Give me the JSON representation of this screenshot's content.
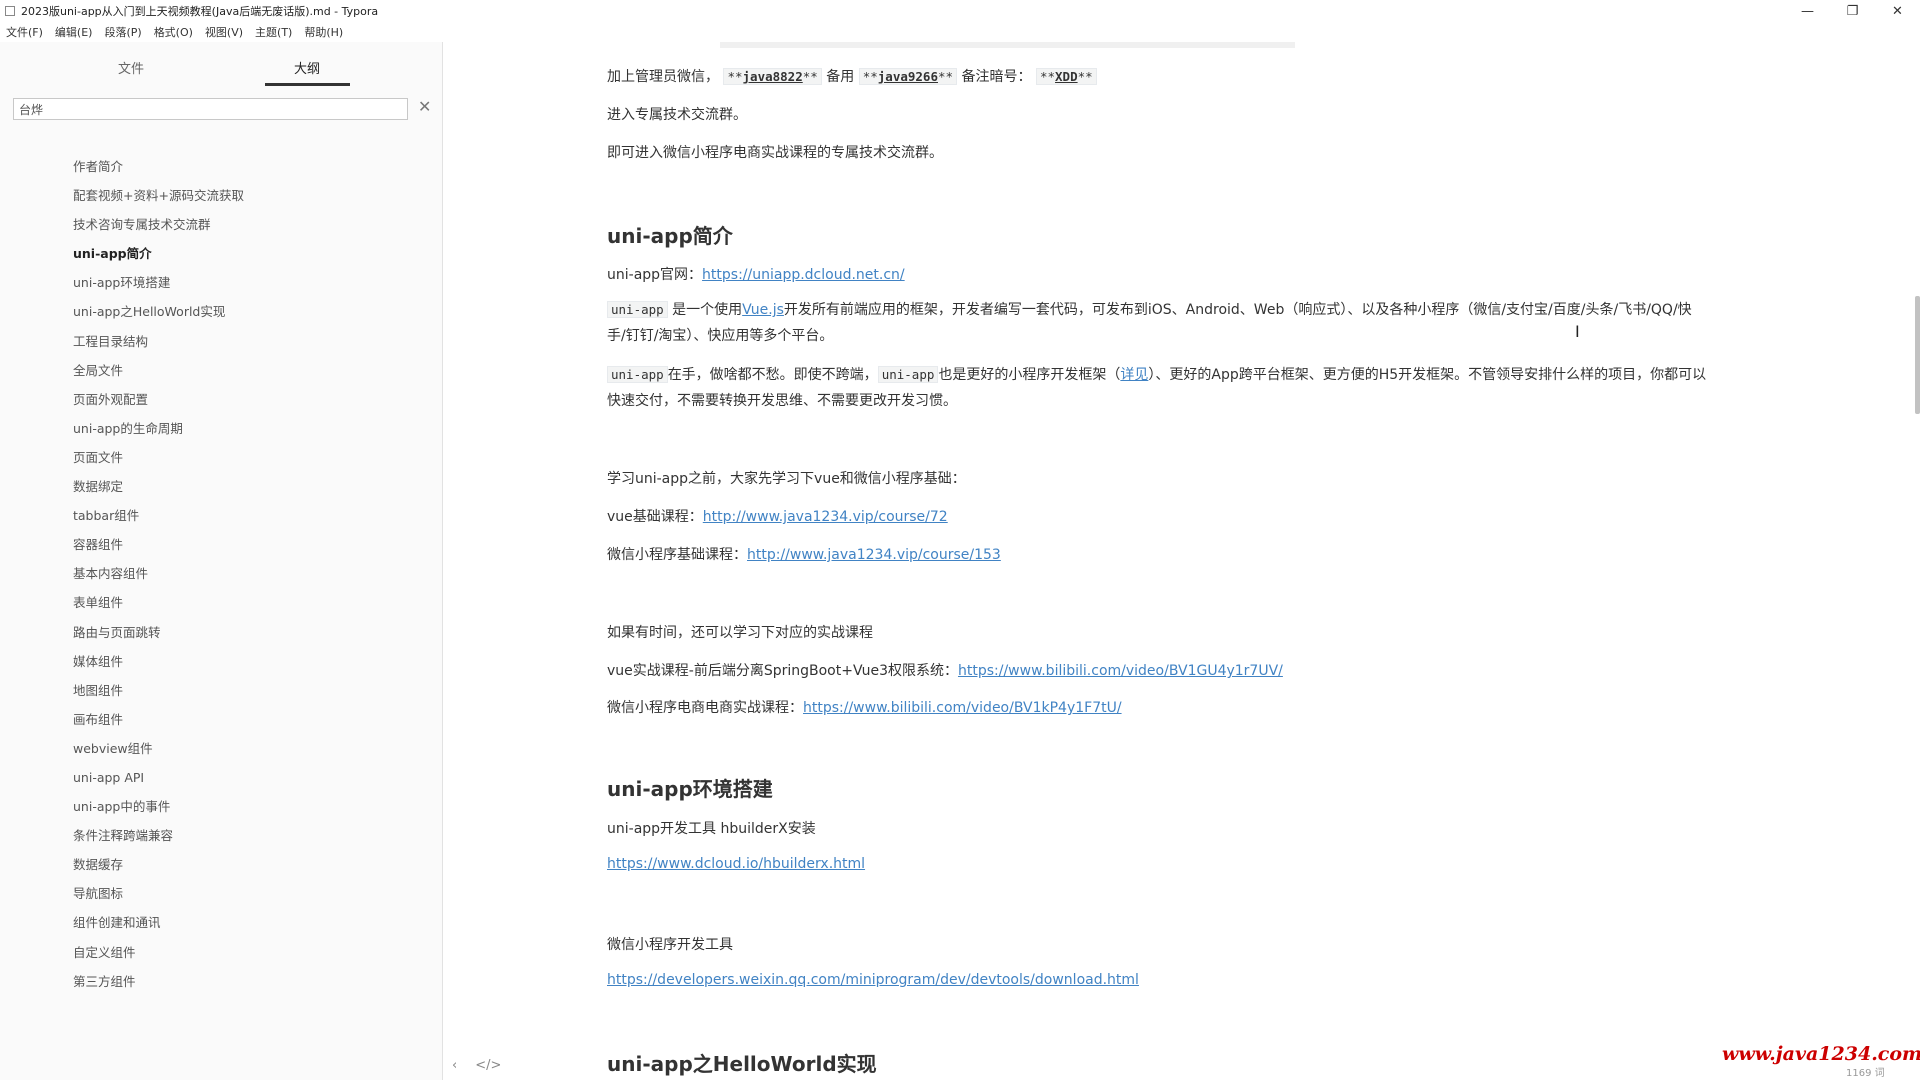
{
  "window": {
    "title": "2023版uni-app从入门到上天视频教程(Java后端无废话版).md - Typora",
    "controls": [
      "—",
      "❐",
      "✕"
    ]
  },
  "menu": [
    "文件(F)",
    "编辑(E)",
    "段落(P)",
    "格式(O)",
    "视图(V)",
    "主题(T)",
    "帮助(H)"
  ],
  "sidebar": {
    "tab_files": "文件",
    "tab_outline": "大纲",
    "search_value": "台烨",
    "clear": "✕",
    "outline": [
      "作者简介",
      "配套视频+资料+源码交流获取",
      "技术咨询专属技术交流群",
      "uni-app简介",
      "uni-app环境搭建",
      "uni-app之HelloWorld实现",
      "工程目录结构",
      "全局文件",
      "页面外观配置",
      "uni-app的生命周期",
      "页面文件",
      "数据绑定",
      "tabbar组件",
      "容器组件",
      "基本内容组件",
      "表单组件",
      "路由与页面跳转",
      "媒体组件",
      "地图组件",
      "画布组件",
      "webview组件",
      "uni-app API",
      "uni-app中的事件",
      "条件注释跨端兼容",
      "数据缓存",
      "导航图标",
      "组件创建和通讯",
      "自定义组件",
      "第三方组件"
    ],
    "active_index": 3,
    "footer_icons": [
      "‹",
      "</>"
    ]
  },
  "doc": {
    "line1_prefix": "加上管理员微信，",
    "line1_id1": "java8822",
    "line1_mid": "备用",
    "line1_id2": "java9266",
    "line1_note": "备注暗号：",
    "line1_code": "XDD",
    "line2": "进入专属技术交流群。",
    "line3": "即可进入微信小程序电商实战课程的专属技术交流群。",
    "h_intro": "uni-app简介",
    "site_label": "uni-app官网：",
    "site_url": "https://uniapp.dcloud.net.cn/",
    "para1_code": "uni-app",
    "para1_a": "是一个使用",
    "para1_vue": "Vue.js",
    "para1_b": "开发所有前端应用的框架，开发者编写一套代码，可发布到iOS、Android、Web（响应式）、以及各种小程序（微信/支付宝/百度/头条/飞书/QQ/快手/钉钉/淘宝）、快应用等多个平台。",
    "para2_code1": "uni-app",
    "para2_a": "在手，做啥都不愁。即使不跨端，",
    "para2_code2": "uni-app",
    "para2_b": "也是更好的小程序开发框架（",
    "para2_link": "详见",
    "para2_c": "）、更好的App跨平台框架、更方便的H5开发框架。不管领导安排什么样的项目，你都可以快速交付，不需要转换开发思维、不需要更改开发习惯。",
    "learn_line": "学习uni-app之前，大家先学习下vue和微信小程序基础：",
    "vue_label": "vue基础课程：",
    "vue_url": "http://www.java1234.vip/course/72",
    "wx_label": "微信小程序基础课程：",
    "wx_url": "http://www.java1234.vip/course/153",
    "more_line": "如果有时间，还可以学习下对应的实战课程",
    "vue_practice_label": "vue实战课程-前后端分离SpringBoot+Vue3权限系统：",
    "vue_practice_url": "https://www.bilibili.com/video/BV1GU4y1r7UV/",
    "wx_practice_label": "微信小程序电商电商实战课程：",
    "wx_practice_url": "https://www.bilibili.com/video/BV1kP4y1F7tU/",
    "h_env": "uni-app环境搭建",
    "tool_line": "uni-app开发工具 hbuilderX安装",
    "hbuilder_url": "https://www.dcloud.io/hbuilderx.html",
    "wx_tool_line": "微信小程序开发工具",
    "wx_tool_url": "https://developers.weixin.qq.com/miniprogram/dev/devtools/download.html",
    "h_hello": "uni-app之HelloWorld实现"
  },
  "status": {
    "word_count": "1169 词"
  },
  "watermark": "www.java1234.com",
  "cursor": "I"
}
